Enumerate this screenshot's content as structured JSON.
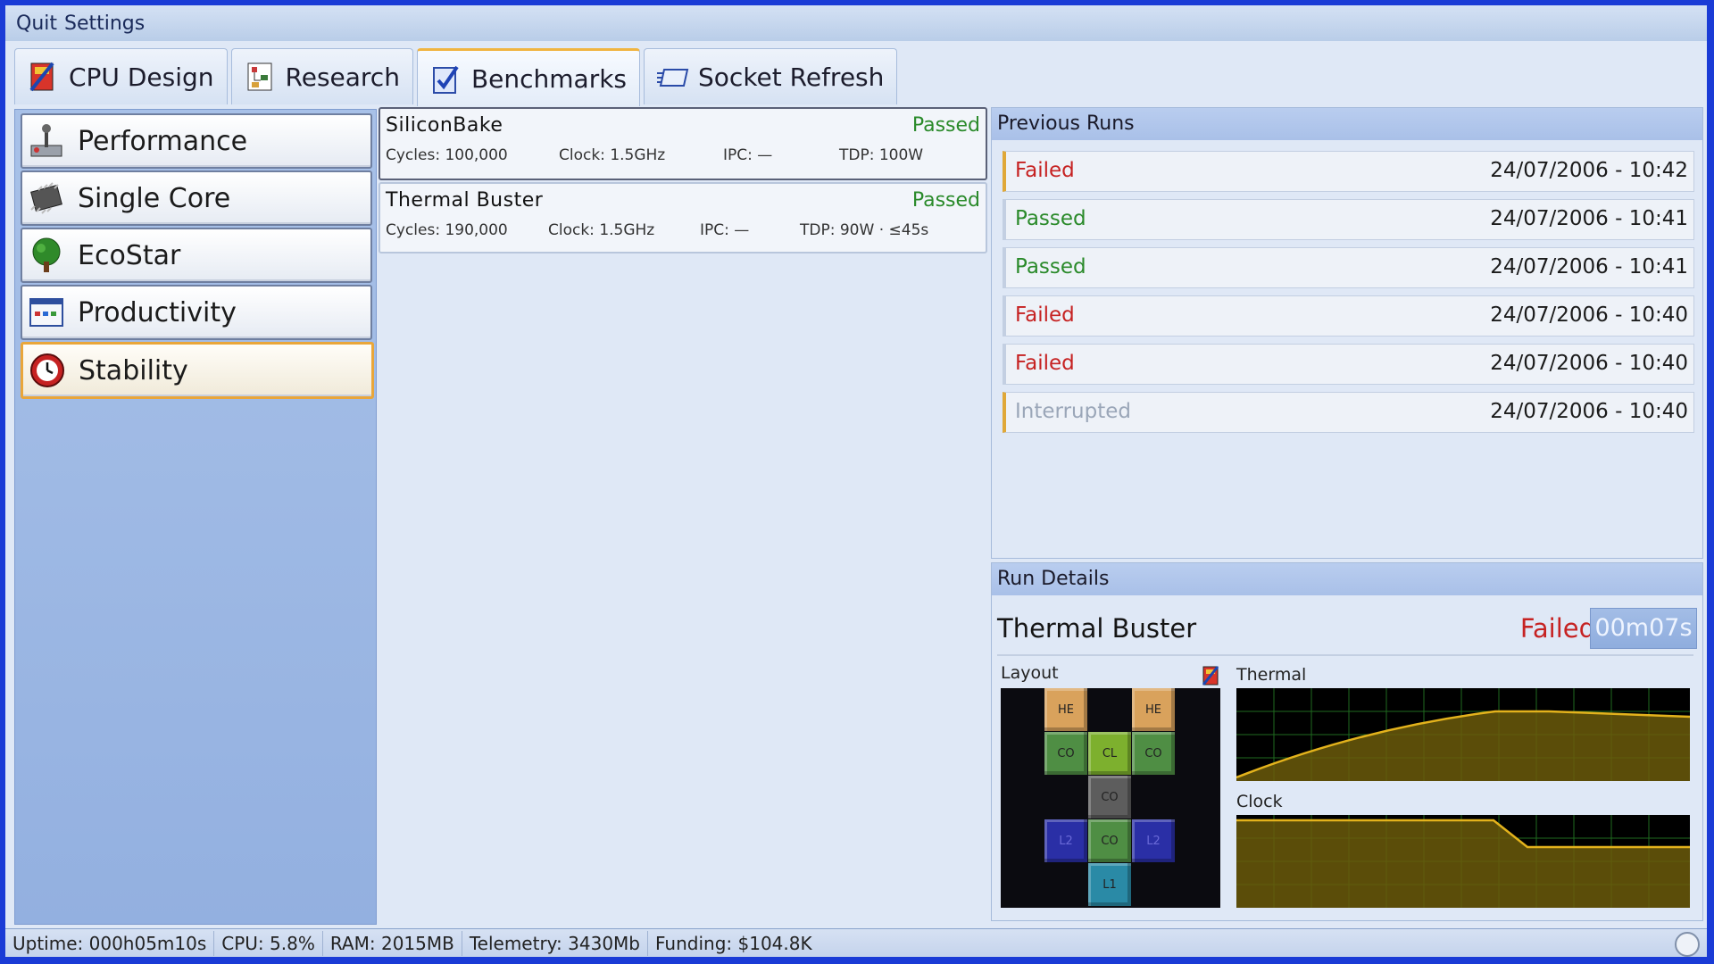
{
  "menu": {
    "quit": "Quit",
    "settings": "Settings"
  },
  "tabs": [
    {
      "label": "CPU Design",
      "icon": "cpu-design-icon"
    },
    {
      "label": "Research",
      "icon": "research-icon"
    },
    {
      "label": "Benchmarks",
      "icon": "benchmarks-icon",
      "active": true
    },
    {
      "label": "Socket Refresh",
      "icon": "socket-refresh-icon"
    }
  ],
  "categories": [
    {
      "label": "Performance",
      "icon": "joystick-icon"
    },
    {
      "label": "Single Core",
      "icon": "chip-icon"
    },
    {
      "label": "EcoStar",
      "icon": "tree-icon"
    },
    {
      "label": "Productivity",
      "icon": "window-icon"
    },
    {
      "label": "Stability",
      "icon": "clock-icon",
      "selected": true
    }
  ],
  "benchmarks": [
    {
      "name": "SiliconBake",
      "status": "Passed",
      "cycles": "Cycles: 100,000",
      "clock": "Clock: 1.5GHz",
      "ipc": "IPC: —",
      "tdp": "TDP: 100W"
    },
    {
      "name": "Thermal Buster",
      "status": "Passed",
      "cycles": "Cycles: 190,000",
      "clock": "Clock: 1.5GHz",
      "ipc": "IPC: —",
      "tdp": "TDP: 90W · ≤45s"
    }
  ],
  "previous_runs": {
    "title": "Previous Runs",
    "runs": [
      {
        "status": "Failed",
        "datetime": "24/07/2006 - 10:42"
      },
      {
        "status": "Passed",
        "datetime": "24/07/2006 - 10:41"
      },
      {
        "status": "Passed",
        "datetime": "24/07/2006 - 10:41"
      },
      {
        "status": "Failed",
        "datetime": "24/07/2006 - 10:40"
      },
      {
        "status": "Failed",
        "datetime": "24/07/2006 - 10:40"
      },
      {
        "status": "Interrupted",
        "datetime": "24/07/2006 - 10:40"
      }
    ]
  },
  "run_details": {
    "title": "Run Details",
    "benchmark": "Thermal Buster",
    "status": "Failed",
    "duration": "00m07s",
    "layout_label": "Layout",
    "thermal_label": "Thermal",
    "clock_label": "Clock",
    "layout_cells": [
      "HE",
      "HE",
      "CO",
      "CL",
      "CO",
      "CO",
      "L2",
      "CO",
      "L2",
      "L1"
    ]
  },
  "statusbar": {
    "uptime": "Uptime: 000h05m10s",
    "cpu": "CPU: 5.8%",
    "ram": "RAM: 2015MB",
    "telemetry": "Telemetry: 3430Mb",
    "funding": "Funding: $104.8K"
  },
  "colors": {
    "failed": "#c62222",
    "passed": "#2a8a2a",
    "interrupted": "#9aa6b8",
    "graph_fill": "#6b5a0a",
    "graph_line": "#e3b21c",
    "graph_grid": "#1f6a1f"
  }
}
